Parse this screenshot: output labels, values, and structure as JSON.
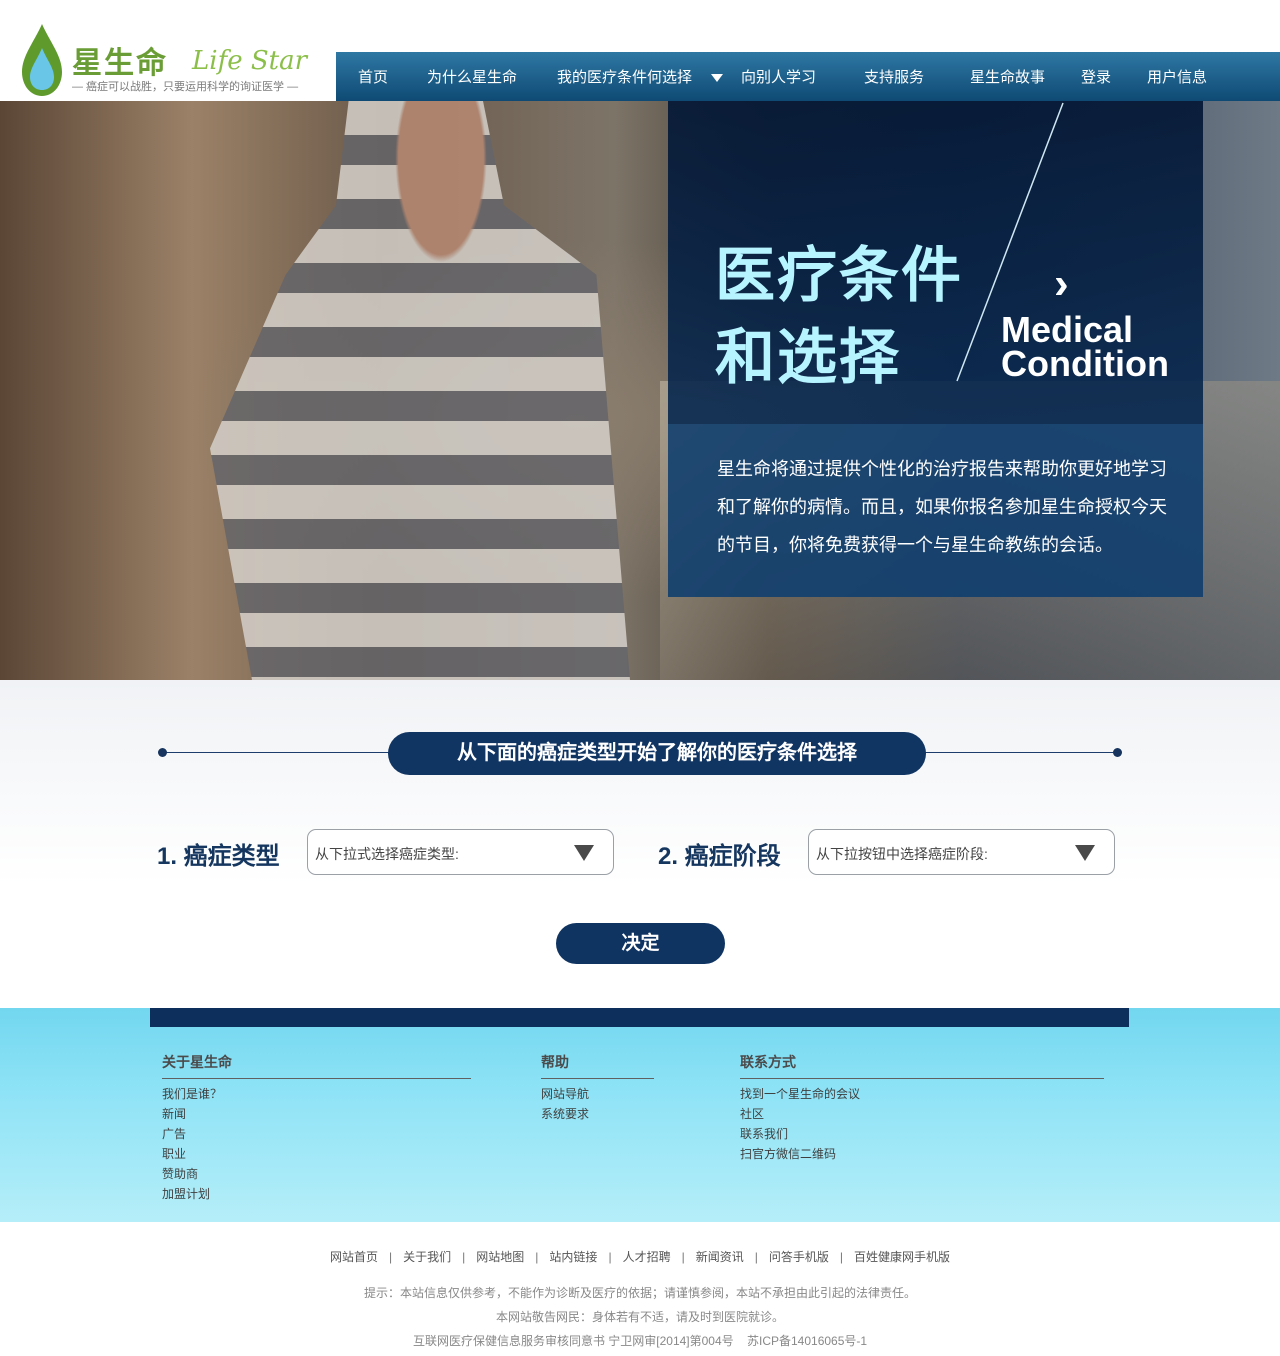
{
  "logo": {
    "name_cn": "星生命",
    "name_en": "Life Star",
    "tagline": "— 癌症可以战胜，只要运用科学的询证医学 —"
  },
  "nav": {
    "items": [
      "首页",
      "为什么星生命",
      "我的医疗条件何选择",
      "向别人学习",
      "支持服务",
      "星生命故事",
      "登录",
      "用户信息"
    ],
    "caret_icon": "triangle-down-icon"
  },
  "hero": {
    "title_line1": "医疗条件",
    "title_line2": "和选择",
    "chevron": "›",
    "en_line1": "Medical",
    "en_line2": "Condition",
    "description": "星生命将通过提供个性化的治疗报告来帮助你更好地学习和了解你的病情。而且，如果你报名参加星生命授权今天的节目，你将免费获得一个与星生命教练的会话。"
  },
  "selector": {
    "banner": "从下面的癌症类型开始了解你的医疗条件选择",
    "step1_label": "1. 癌症类型",
    "step1_placeholder": "从下拉式选择癌症类型:",
    "step2_label": "2. 癌症阶段",
    "step2_placeholder": "从下拉按钮中选择癌症阶段:",
    "submit": "决定"
  },
  "footer": {
    "col1": {
      "heading": "关于星生命",
      "links": [
        "我们是谁？",
        "新闻",
        "广告",
        "职业",
        "赞助商",
        "加盟计划"
      ]
    },
    "col2": {
      "heading": "帮助",
      "links": [
        "网站导航",
        "系统要求"
      ]
    },
    "col3": {
      "heading": "联系方式",
      "links": [
        "找到一个星生命的会议",
        "社区",
        "联系我们",
        "扫官方微信二维码"
      ]
    }
  },
  "bottom": {
    "links": [
      "网站首页",
      "关于我们",
      "网站地图",
      "站内链接",
      "人才招聘",
      "新闻资讯",
      "问答手机版",
      "百姓健康网手机版"
    ],
    "separator": "|",
    "notice1": "提示：本站信息仅供参考，不能作为诊断及医疗的依据；请谨慎参阅，本站不承担由此引起的法律责任。",
    "notice2": "本网站敬告网民：身体若有不适，请及时到医院就诊。",
    "notice3": "互联网医疗保健信息服务审核同意书 宁卫网审[2014]第004号    苏ICP备14016065号-1"
  },
  "colors": {
    "nav": "#1b5f8c",
    "navy": "#0f3462",
    "logo_green": "#6a9d35",
    "hero_title": "#b6f4ff",
    "footer_bg": "#8fe3f6"
  }
}
